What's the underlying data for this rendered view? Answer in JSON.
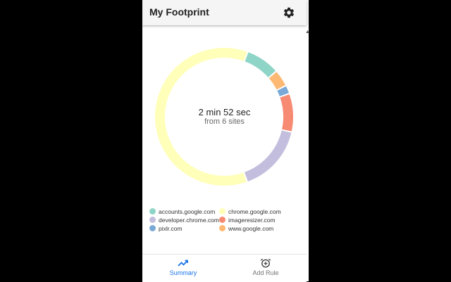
{
  "app": {
    "title": "My Footprint",
    "settings_icon": "gear-icon"
  },
  "summary": {
    "total_time": "2 min 52 sec",
    "sites_text": "from 6 sites"
  },
  "colors": {
    "accounts.google.com": "#8fd5c7",
    "chrome.google.com": "#ffffba",
    "developer.chrome.com": "#c3bedd",
    "imageresizer.com": "#f78a72",
    "pixlr.com": "#7aa9d7",
    "www.google.com": "#fdb873",
    "active_tab": "#1a73e8"
  },
  "chart_data": {
    "type": "pie",
    "title": "",
    "slices": [
      {
        "label": "accounts.google.com",
        "value": 8
      },
      {
        "label": "www.google.com",
        "value": 4
      },
      {
        "label": "pixlr.com",
        "value": 2
      },
      {
        "label": "imageresizer.com",
        "value": 9
      },
      {
        "label": "developer.chrome.com",
        "value": 16
      },
      {
        "label": "chrome.google.com",
        "value": 61
      }
    ]
  },
  "legend": [
    {
      "label": "accounts.google.com",
      "color": "#8fd5c7"
    },
    {
      "label": "chrome.google.com",
      "color": "#ffffba"
    },
    {
      "label": "developer.chrome.com",
      "color": "#c3bedd"
    },
    {
      "label": "imageresizer.com",
      "color": "#f78a72"
    },
    {
      "label": "pixlr.com",
      "color": "#7aa9d7"
    },
    {
      "label": "www.google.com",
      "color": "#fdb873"
    }
  ],
  "nav": {
    "summary_label": "Summary",
    "summary_icon": "trending-up-icon",
    "add_rule_label": "Add Rule",
    "add_rule_icon": "add-alarm-icon"
  }
}
